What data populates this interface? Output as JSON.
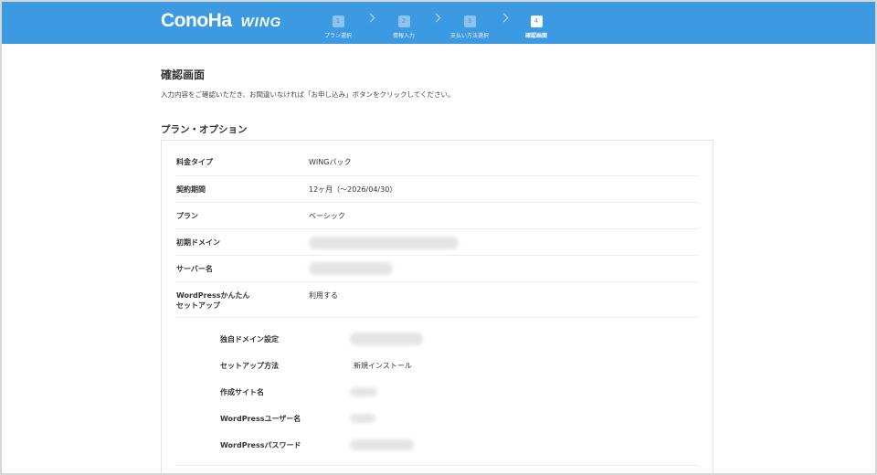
{
  "header": {
    "logo_mark": "ConoHa",
    "logo_wing": "WING",
    "steps": [
      {
        "num": "1",
        "label": "プラン選択"
      },
      {
        "num": "2",
        "label": "情報入力"
      },
      {
        "num": "3",
        "label": "支払い方法選択"
      },
      {
        "num": "4",
        "label": "確認画面"
      }
    ],
    "active_step": 4
  },
  "page": {
    "title": "確認画面",
    "description": "入力内容をご確認いただき、お間違いなければ「お申し込み」ボタンをクリックしてください。",
    "section_title": "プラン・オプション"
  },
  "rows": [
    {
      "label": "料金タイプ",
      "value": "WINGパック"
    },
    {
      "label": "契約期間",
      "value": "12ヶ月（〜2026/04/30）"
    },
    {
      "label": "プラン",
      "value": "ベーシック"
    },
    {
      "label": "初期ドメイン",
      "value": ""
    },
    {
      "label": "サーバー名",
      "value": ""
    },
    {
      "label_line1": "WordPressかんたん",
      "label_line2": "セットアップ",
      "value": "利用する"
    }
  ],
  "wordpress_rows": [
    {
      "label": "独自ドメイン設定",
      "value": ""
    },
    {
      "label": "セットアップ方法",
      "value": "新規インストール"
    },
    {
      "label": "作成サイト名",
      "value": ""
    },
    {
      "label": "WordPressユーザー名",
      "value": ""
    },
    {
      "label": "WordPressパスワード",
      "value": ""
    }
  ],
  "colors": {
    "header_bg": "#3b9ae1",
    "accent": "#3b9ae1"
  }
}
